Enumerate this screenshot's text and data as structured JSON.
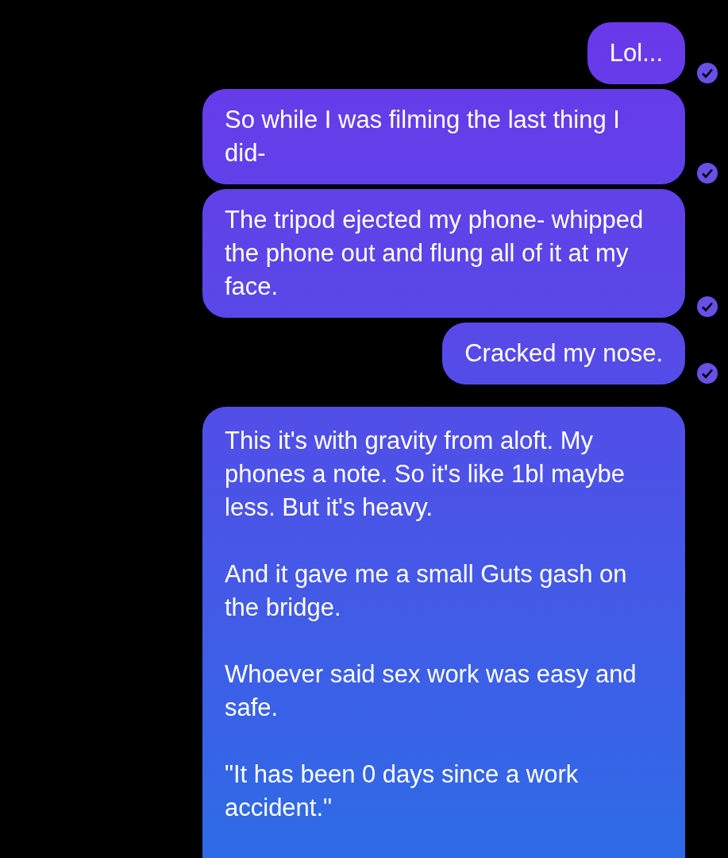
{
  "messages": [
    {
      "paragraphs": [
        "Lol..."
      ],
      "read": true
    },
    {
      "paragraphs": [
        "So while I was filming the last thing I did-"
      ],
      "read": true
    },
    {
      "paragraphs": [
        "The tripod ejected my phone- whipped the phone out and flung all of it at my face."
      ],
      "read": true
    },
    {
      "paragraphs": [
        "Cracked my nose."
      ],
      "read": true
    },
    {
      "paragraphs": [
        "This it's with gravity from aloft. My phones a note. So it's like 1bl maybe less. But it's heavy.",
        "And it gave me a small Guts gash on the bridge.",
        "Whoever said sex work was easy and safe.",
        "\"It has been 0 days since a work accident.\""
      ]
    }
  ]
}
